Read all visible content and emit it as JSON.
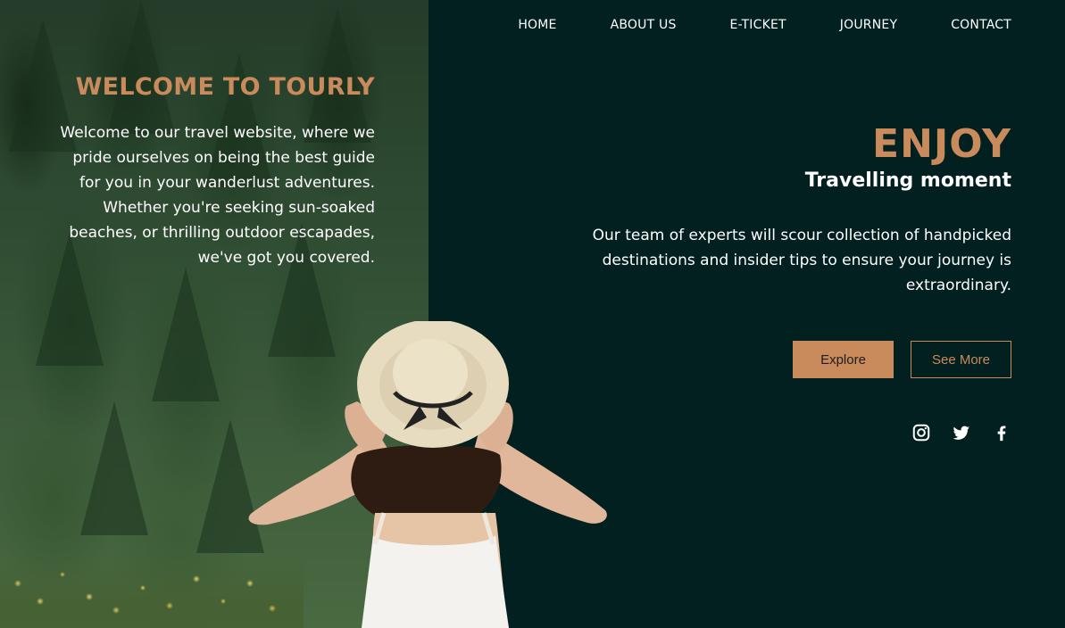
{
  "nav": {
    "items": [
      {
        "label": "HOME"
      },
      {
        "label": "ABOUT US"
      },
      {
        "label": "E-TICKET"
      },
      {
        "label": "JOURNEY"
      },
      {
        "label": "CONTACT"
      }
    ]
  },
  "welcome": {
    "title": "WELCOME TO TOURLY",
    "body": "Welcome to our travel website, where we pride ourselves on being the best guide for you in your wanderlust adventures. Whether you're seeking sun-soaked beaches, or thrilling outdoor escapades, we've got you covered."
  },
  "hero": {
    "headline": "ENJOY",
    "subheadline": "Travelling moment",
    "body": "Our team of experts will scour collection of handpicked destinations and insider tips to ensure your journey is extraordinary."
  },
  "buttons": {
    "explore": "Explore",
    "see_more": "See More"
  },
  "social": [
    "instagram-icon",
    "twitter-icon",
    "facebook-icon"
  ],
  "colors": {
    "accent": "#c98a5c",
    "background": "#022020",
    "text": "#ffffff"
  }
}
